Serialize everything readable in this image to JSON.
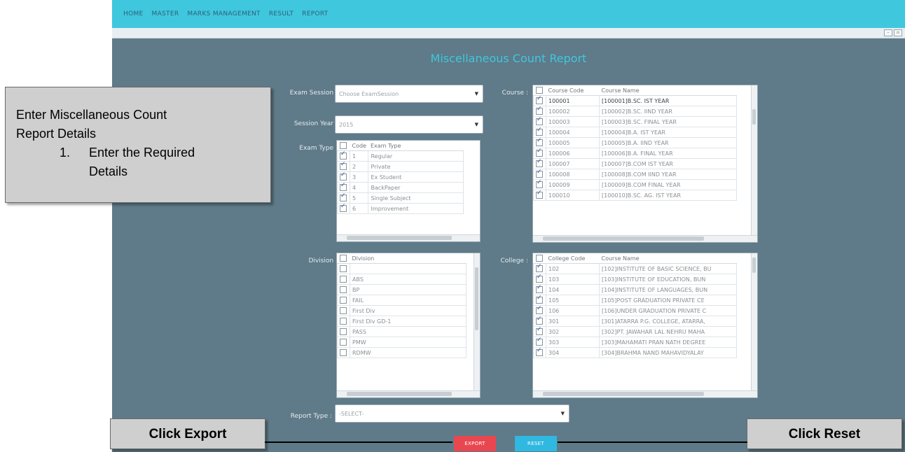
{
  "nav": {
    "items": [
      "HOME",
      "MASTER",
      "MARKS MANAGEMENT",
      "RESULT",
      "REPORT"
    ]
  },
  "title": "Miscellaneous Count Report",
  "exam_session": {
    "label": "Exam Session :",
    "value": "Choose ExamSession"
  },
  "session_year": {
    "label": "Session Year :",
    "value": "2015"
  },
  "exam_type": {
    "label": "Exam Type :",
    "headers": [
      "Code",
      "Exam Type"
    ],
    "rows": [
      {
        "code": "1",
        "name": "Regular"
      },
      {
        "code": "2",
        "name": "Private"
      },
      {
        "code": "3",
        "name": "Ex Student"
      },
      {
        "code": "4",
        "name": "BackPaper"
      },
      {
        "code": "5",
        "name": "Single Subject"
      },
      {
        "code": "6",
        "name": "Improvement"
      }
    ]
  },
  "course": {
    "label": "Course :",
    "headers": [
      "Course Code",
      "Course Name"
    ],
    "rows": [
      {
        "code": "100001",
        "name": "[100001]B.SC. IST YEAR"
      },
      {
        "code": "100002",
        "name": "[100002]B.SC. IIND YEAR"
      },
      {
        "code": "100003",
        "name": "[100003]B.SC. FINAL YEAR"
      },
      {
        "code": "100004",
        "name": "[100004]B.A. IST YEAR"
      },
      {
        "code": "100005",
        "name": "[100005]B.A. IIND YEAR"
      },
      {
        "code": "100006",
        "name": "[100006]B.A. FINAL YEAR"
      },
      {
        "code": "100007",
        "name": "[100007]B.COM IST YEAR"
      },
      {
        "code": "100008",
        "name": "[100008]B.COM IIND YEAR"
      },
      {
        "code": "100009",
        "name": "[100009]B.COM FINAL YEAR"
      },
      {
        "code": "100010",
        "name": "[100010]B.SC. AG. IST YEAR"
      }
    ]
  },
  "division": {
    "label": "Division :",
    "header": "Division",
    "rows": [
      "",
      "ABS",
      "BP",
      "FAIL",
      "First Div",
      "First Div GD-1",
      "PASS",
      "PMW",
      "RDMW"
    ]
  },
  "college": {
    "label": "College :",
    "headers": [
      "College Code",
      "Course Name"
    ],
    "rows": [
      {
        "code": "102",
        "name": "[102]INSTITUTE OF BASIC SCIENCE, BU"
      },
      {
        "code": "103",
        "name": "[103]INSTITUTE OF EDUCATION, BUN"
      },
      {
        "code": "104",
        "name": "[104]INSTITUTE OF LANGUAGES, BUN"
      },
      {
        "code": "105",
        "name": "[105]POST GRADUATION PRIVATE CE"
      },
      {
        "code": "106",
        "name": "[106]UNDER GRADUATION PRIVATE C"
      },
      {
        "code": "301",
        "name": "[301]ATARRA P.G. COLLEGE, ATARRA,"
      },
      {
        "code": "302",
        "name": "[302]PT. JAWAHAR LAL NEHRU MAHA"
      },
      {
        "code": "303",
        "name": "[303]MAHAMATI PRAN NATH DEGREE"
      },
      {
        "code": "304",
        "name": "[304]BRAHMA NAND MAHAVIDYALAY"
      }
    ]
  },
  "report_type": {
    "label": "Report Type :",
    "value": "-SELECT-"
  },
  "buttons": {
    "export": "EXPORT",
    "reset": "RESET"
  },
  "callouts": {
    "details_line1": "Enter Miscellaneous Count",
    "details_line2": "Report Details",
    "details_step_num": "1.",
    "details_step_line1": "Enter the Required",
    "details_step_line2": "Details",
    "export": "Click Export",
    "reset": "Click Reset"
  },
  "colors": {
    "nav": "#3fc7de",
    "panel": "#5f7a88",
    "export": "#e9474f",
    "reset": "#2fb8e0",
    "callout": "#cfcfcf"
  }
}
